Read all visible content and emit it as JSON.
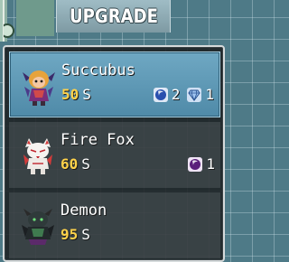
{
  "header": {
    "title": "UPGRADE"
  },
  "items": [
    {
      "name": "Succubus",
      "cost": "50",
      "cost_unit": "S",
      "selected": true,
      "materials": [
        {
          "icon": "blue-orb-icon",
          "count": "2"
        },
        {
          "icon": "diamond-icon",
          "count": "1"
        }
      ]
    },
    {
      "name": "Fire Fox",
      "cost": "60",
      "cost_unit": "S",
      "selected": false,
      "materials": [
        {
          "icon": "purple-orb-icon",
          "count": "1"
        }
      ]
    },
    {
      "name": "Demon",
      "cost": "95",
      "cost_unit": "S",
      "selected": false,
      "materials": []
    }
  ],
  "colors": {
    "selected_bg": "#5e9ab8",
    "cost": "#ffd24a",
    "window_border": "#d5dadb"
  }
}
